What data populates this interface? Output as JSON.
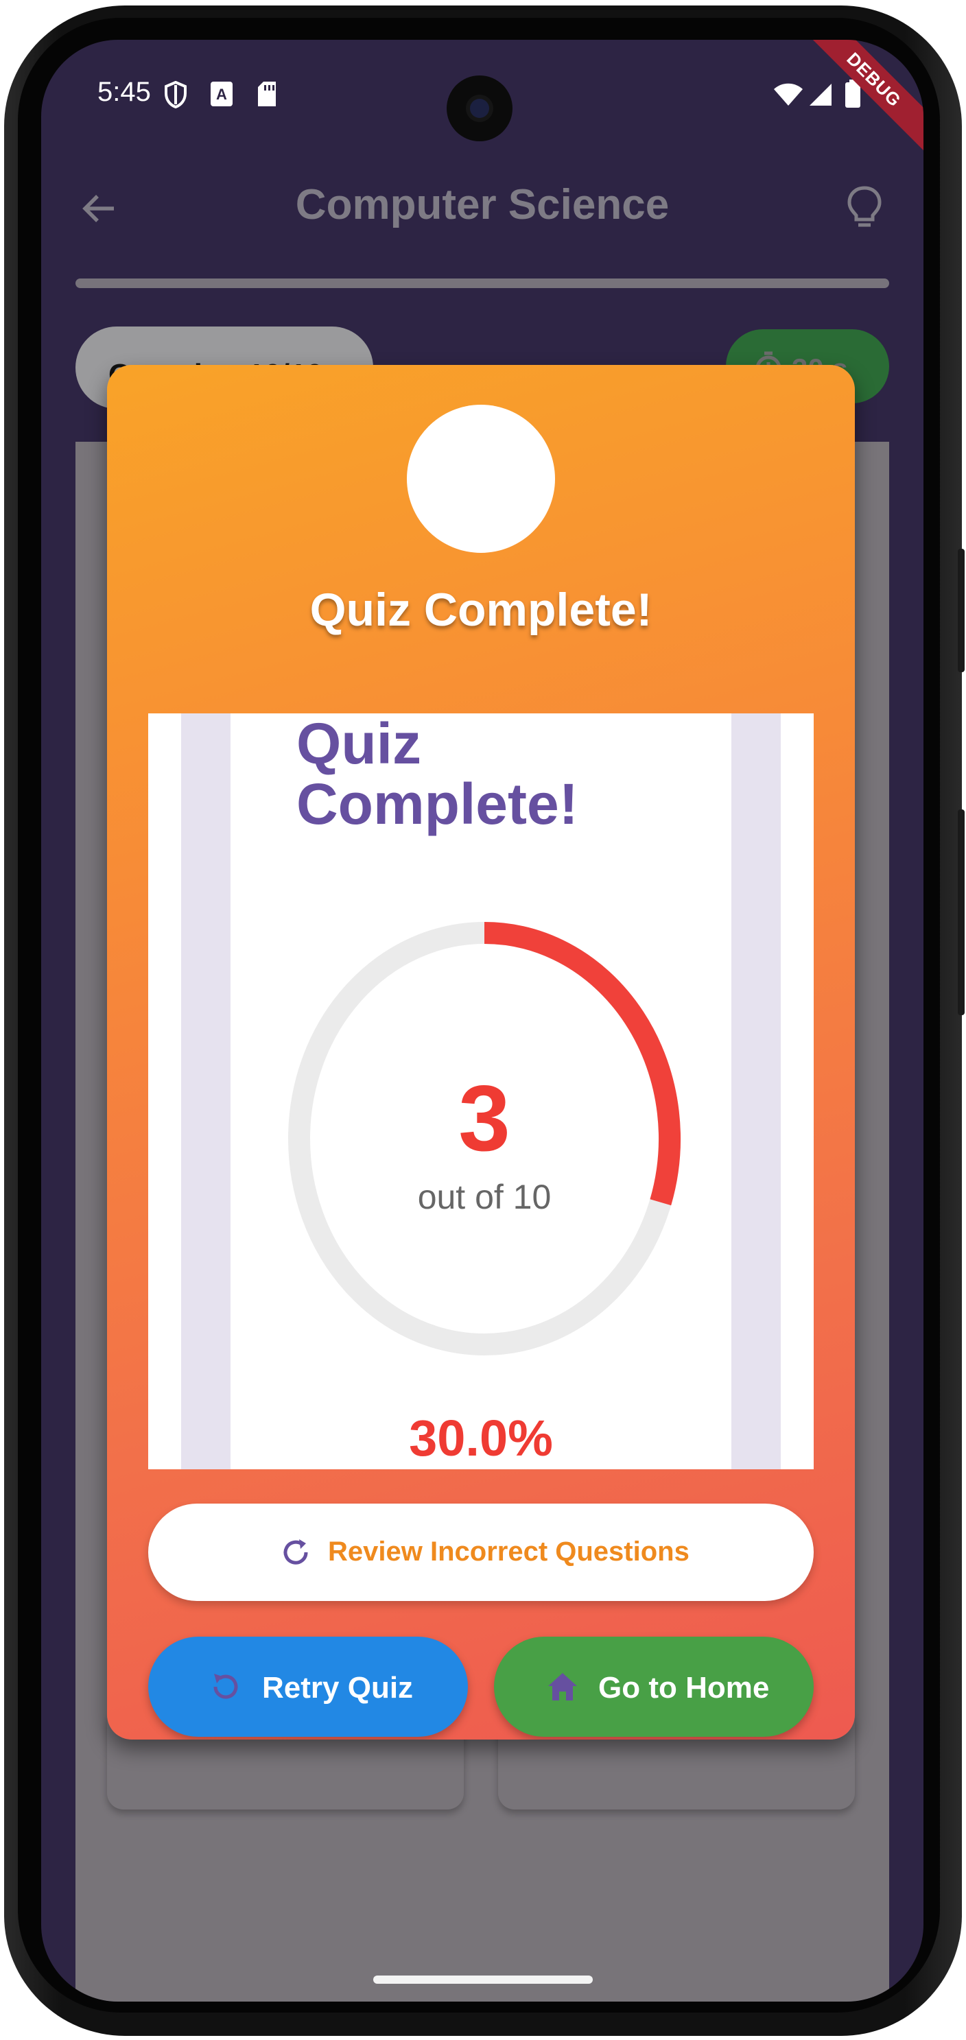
{
  "status_bar": {
    "time": "5:45",
    "debug_label": "DEBUG"
  },
  "app_bar": {
    "title": "Computer Science"
  },
  "quiz_header": {
    "question_counter": "Question 10/10",
    "timer": "30 s"
  },
  "dialog": {
    "title": "Quiz Complete!",
    "result_heading": "Quiz Complete!",
    "score": "3",
    "score_total_text": "out of 10",
    "score_fraction": 0.3,
    "percentage": "30.0%",
    "review_button_label": "Review Incorrect Questions",
    "retry_button_label": "Retry Quiz",
    "home_button_label": "Go to Home"
  },
  "colors": {
    "app_background": "#2d2444",
    "dialog_gradient_start": "#f9a328",
    "dialog_gradient_end": "#ee5a50",
    "score_red": "#ef3b33",
    "heading_purple": "#6650a0",
    "review_text_orange": "#ef8a1e",
    "retry_blue": "#2288e4",
    "home_green": "#48a046"
  },
  "icons": [
    "shield-icon",
    "font-icon",
    "sd-card-icon",
    "wifi-icon",
    "signal-icon",
    "battery-icon",
    "back-arrow-icon",
    "lightbulb-icon",
    "timer-icon",
    "refresh-icon",
    "replay-icon",
    "home-icon"
  ]
}
